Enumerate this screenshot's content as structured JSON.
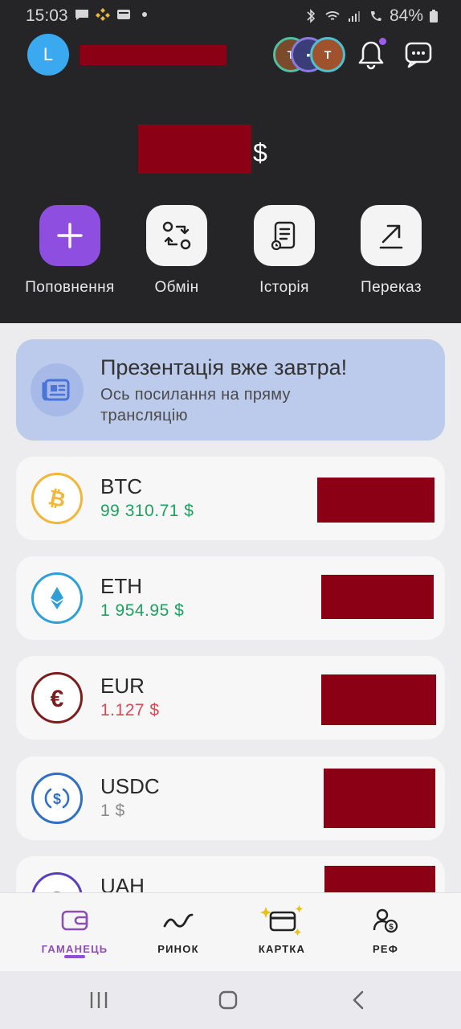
{
  "status_bar": {
    "time": "15:03",
    "battery": "84%"
  },
  "header": {
    "avatar_letter": "L",
    "balance_currency": "$"
  },
  "actions": [
    {
      "label": "Поповнення",
      "icon": "plus-icon"
    },
    {
      "label": "Обмін",
      "icon": "exchange-icon"
    },
    {
      "label": "Історія",
      "icon": "history-icon"
    },
    {
      "label": "Переказ",
      "icon": "transfer-arrow-icon"
    }
  ],
  "banner": {
    "title": "Презентація вже завтра!",
    "subtitle": "Ось посилання на пряму трансляцію",
    "icon": "newspaper-icon"
  },
  "assets": [
    {
      "symbol": "BTC",
      "price": "99 310.71 $",
      "price_color": "#1fa060",
      "icon": "bitcoin-icon",
      "accent": "#f2b63a"
    },
    {
      "symbol": "ETH",
      "price": "1 954.95 $",
      "price_color": "#1fa060",
      "icon": "ethereum-icon",
      "accent": "#2f9fd8"
    },
    {
      "symbol": "EUR",
      "price": "1.127 $",
      "price_color": "#d64b55",
      "icon": "euro-icon",
      "accent": "#7d1e1e"
    },
    {
      "symbol": "USDC",
      "price": "1 $",
      "price_color": "#8a8a8a",
      "icon": "usdc-icon",
      "accent": "#2f6fc4"
    },
    {
      "symbol": "UAH",
      "price": "",
      "price_color": "#8a8a8a",
      "icon": "hryvnia-icon",
      "accent": "#5a3fc0"
    }
  ],
  "bottom_nav": [
    {
      "label": "ГАМАНЕЦЬ",
      "icon": "wallet-icon",
      "active": true
    },
    {
      "label": "РИНОК",
      "icon": "market-chart-icon",
      "active": false
    },
    {
      "label": "КАРТКА",
      "icon": "card-icon",
      "active": false
    },
    {
      "label": "РЕФ",
      "icon": "referral-icon",
      "active": false
    }
  ],
  "colors": {
    "accent": "#8e4fe0",
    "header_bg": "#252527",
    "redaction": "#8b0015"
  }
}
